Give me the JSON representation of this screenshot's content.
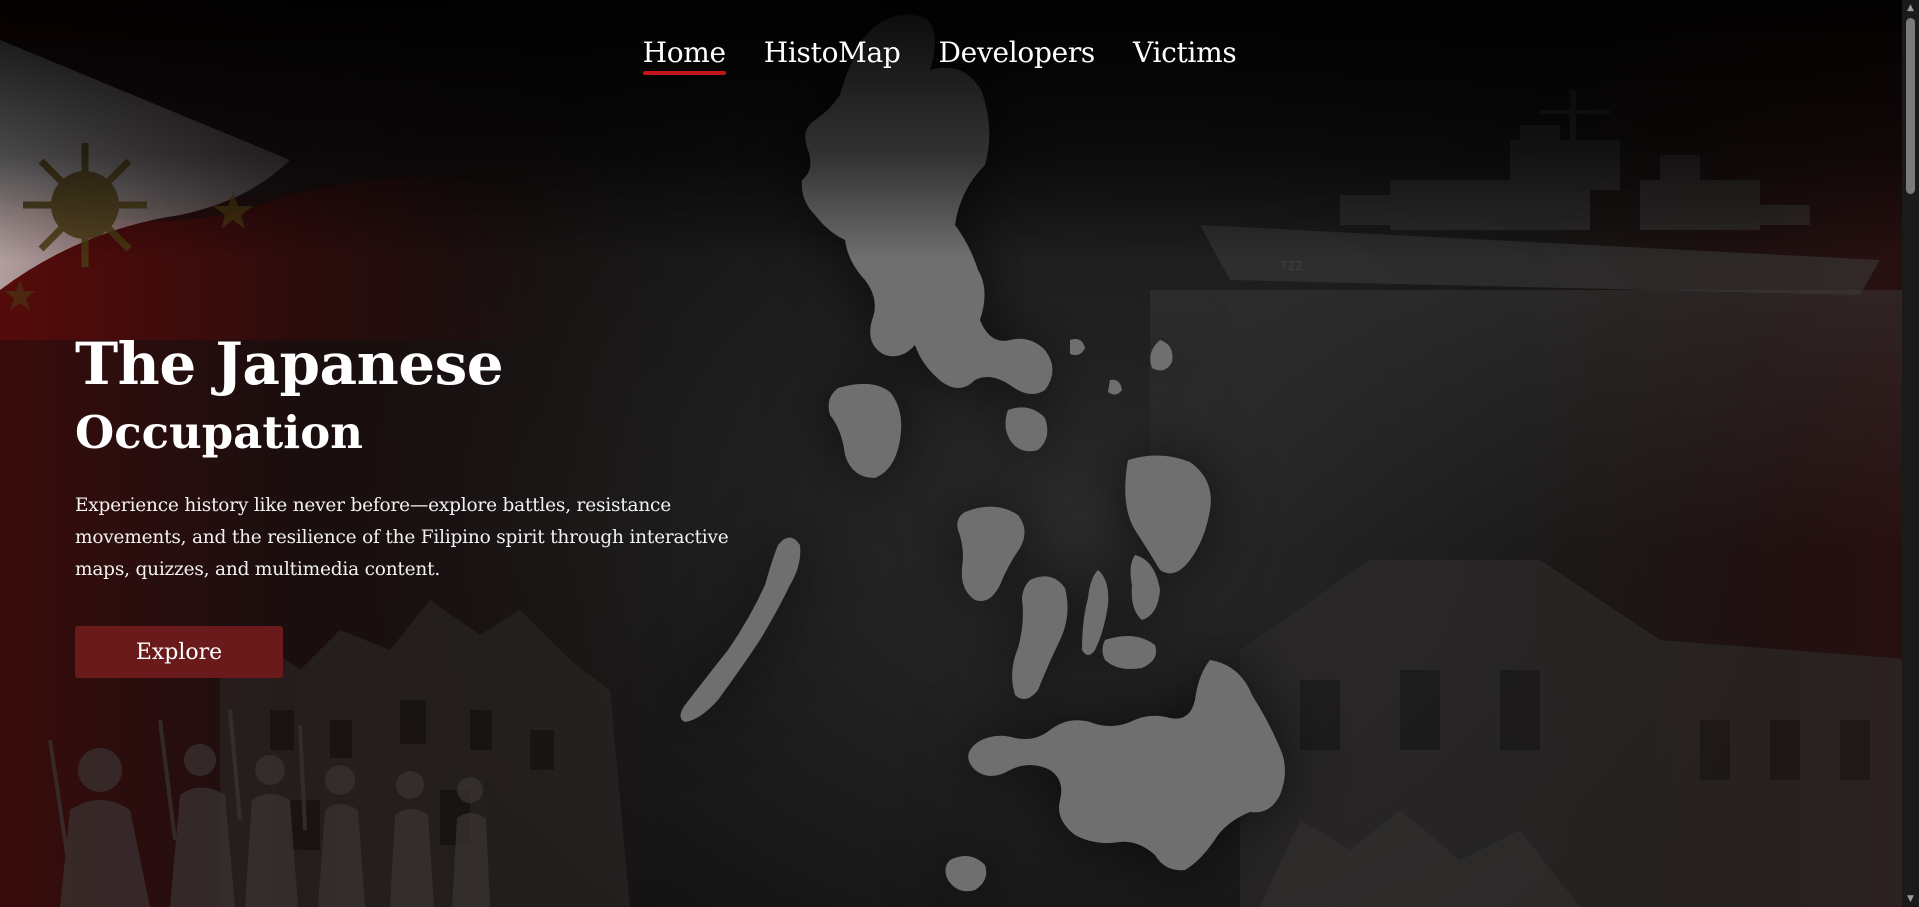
{
  "nav": {
    "items": [
      {
        "label": "Home",
        "active": true
      },
      {
        "label": "HistoMap",
        "active": false
      },
      {
        "label": "Developers",
        "active": false
      },
      {
        "label": "Victims",
        "active": false
      }
    ]
  },
  "hero": {
    "title": "The Japanese",
    "subtitle": "Occupation",
    "description": "Experience history like never before—explore battles, resistance movements, and the resilience of the Filipino spirit through interactive maps, quizzes, and multimedia content.",
    "button_label": "Explore"
  },
  "colors": {
    "accent_red": "#c4161c",
    "button_bg": "#6b1a1c",
    "map_fill": "#6f6f6f"
  },
  "icons": {
    "background_map": "philippines-map-silhouette",
    "flag": "philippine-flag-image",
    "ship": "warship-photo",
    "soldiers": "soldiers-photo",
    "ruins": "ruins-photo"
  }
}
